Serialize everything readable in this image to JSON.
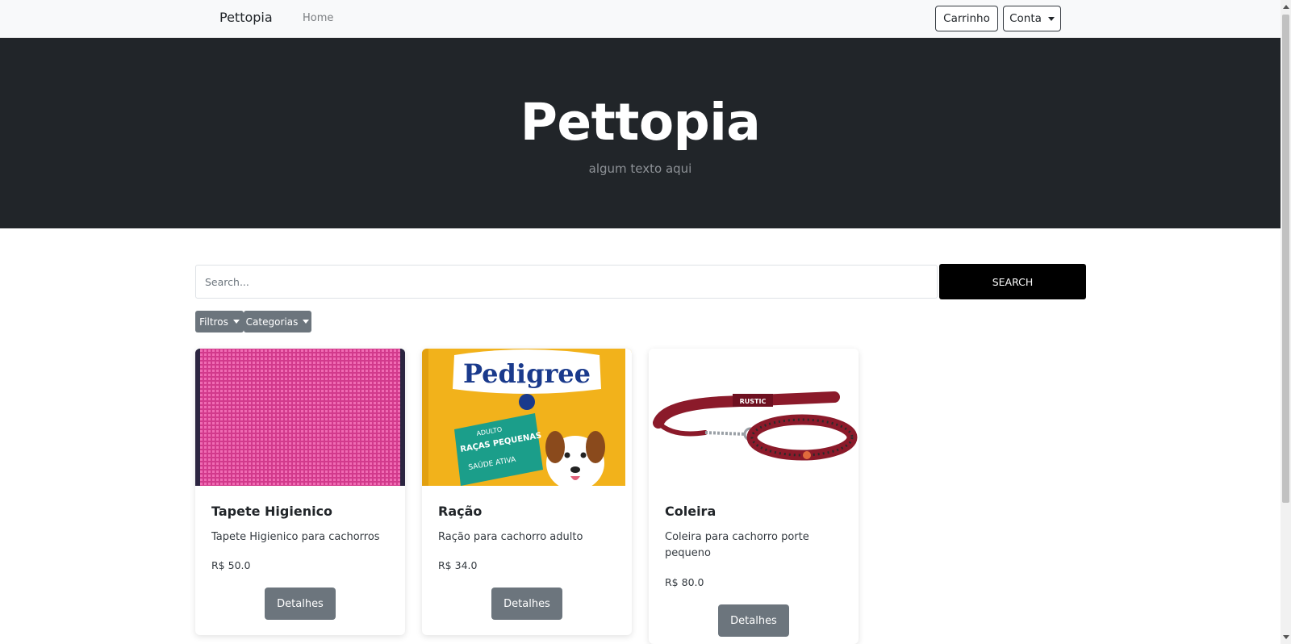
{
  "navbar": {
    "brand": "Pettopia",
    "home": "Home",
    "cart_label": "Carrinho",
    "account_label": "Conta"
  },
  "hero": {
    "title": "Pettopia",
    "subtitle": "algum texto aqui"
  },
  "search": {
    "placeholder": "Search...",
    "button_label": "SEARCH"
  },
  "filters": {
    "filtros_label": "Filtros",
    "categorias_label": "Categorias"
  },
  "products": [
    {
      "title": "Tapete Higienico",
      "description": "Tapete Higienico para cachorros",
      "price": "R$ 50.0",
      "button_label": "Detalhes",
      "image_icon": "hygienic-mat-image"
    },
    {
      "title": "Ração",
      "description": "Ração para cachorro adulto",
      "price": "R$ 34.0",
      "button_label": "Detalhes",
      "image_icon": "dog-food-bag-image",
      "image_text": {
        "brand": "Pedigree",
        "line1": "ADULTO",
        "line2": "RAÇAS PEQUENAS",
        "line3": "SAÚDE ATIVA"
      }
    },
    {
      "title": "Coleira",
      "description": "Coleira para cachorro porte pequeno",
      "price": "R$ 80.0",
      "button_label": "Detalhes",
      "image_icon": "dog-collar-leash-image",
      "image_text": {
        "tag": "RUSTIC"
      }
    }
  ],
  "colors": {
    "navbar_bg": "#f8f9fa",
    "hero_bg": "#212529",
    "secondary_button": "#6c757d",
    "search_button": "#000000",
    "collar_red": "#8b1a2a",
    "mat_pink": "#e0439a",
    "pedigree_yellow": "#f2b21b"
  }
}
